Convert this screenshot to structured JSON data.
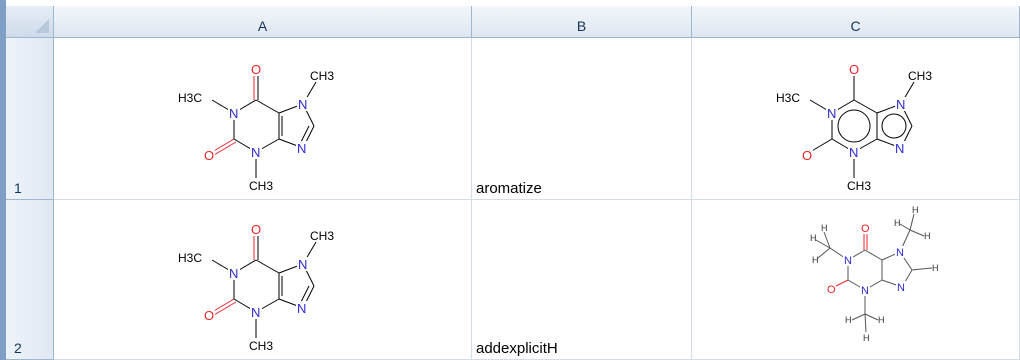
{
  "columns": [
    {
      "label": "A"
    },
    {
      "label": "B"
    },
    {
      "label": "C"
    }
  ],
  "rows": [
    {
      "number": "1",
      "b_text": "aromatize"
    },
    {
      "number": "2",
      "b_text": "addexplicitH"
    }
  ],
  "molecule_labels": {
    "o": "O",
    "n": "N",
    "h3c": "H3C",
    "ch3": "CH3",
    "h": "H"
  },
  "colors": {
    "oxygen": "#e8262a",
    "nitrogen": "#2e2bcf",
    "bond": "#000000",
    "header_text": "#16335a",
    "header_border": "#9eb6ce"
  }
}
